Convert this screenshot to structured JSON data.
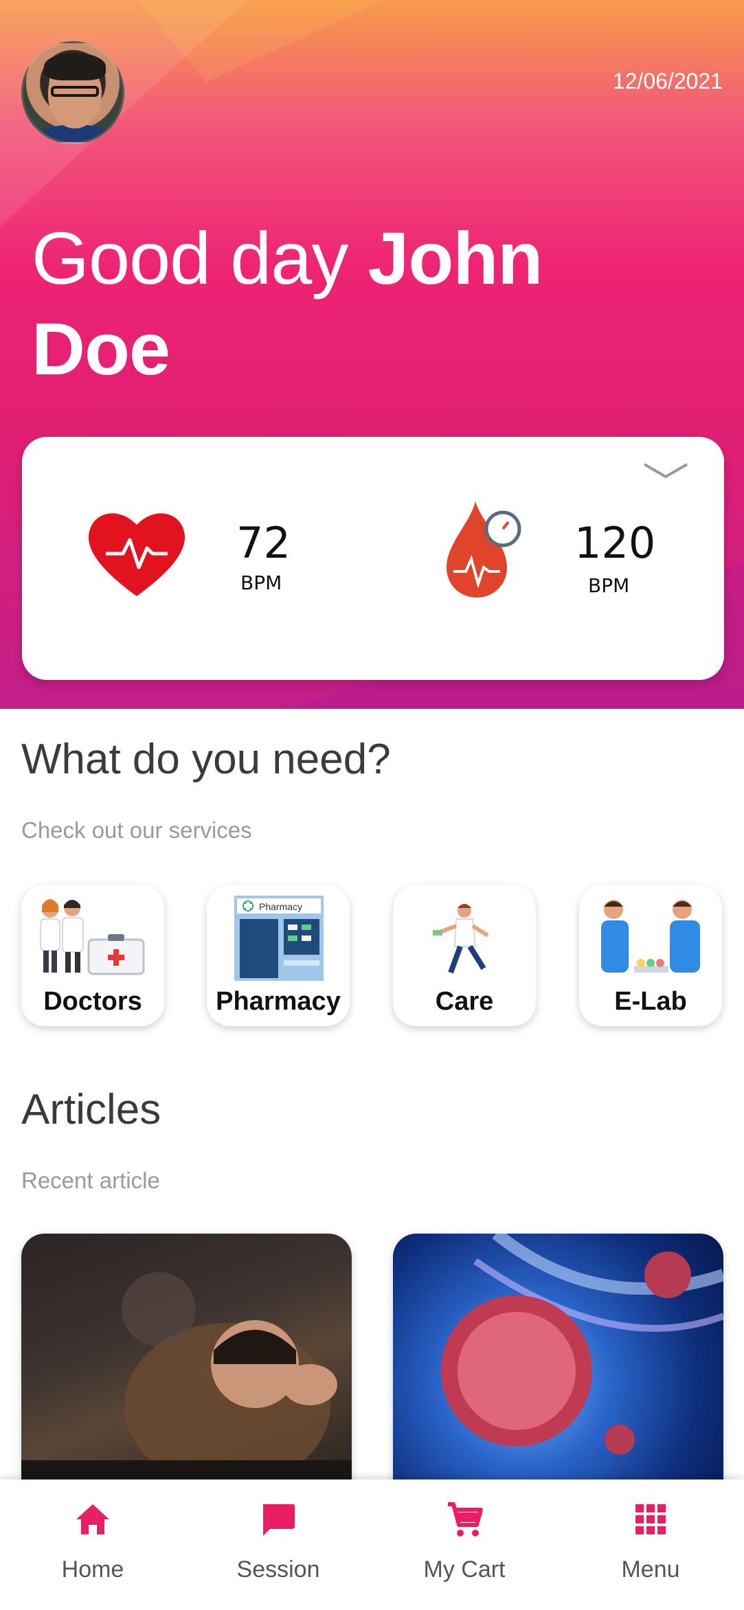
{
  "header": {
    "date": "12/06/2021",
    "greeting_prefix": "Good day",
    "user_first_name": "John",
    "user_last_name": "Doe"
  },
  "vitals": {
    "heart_rate": {
      "value": "72",
      "unit": "BPM",
      "icon": "heart-pulse-icon"
    },
    "blood_pressure": {
      "value": "120",
      "unit": "BPM",
      "icon": "blood-drop-gauge-icon"
    },
    "expand_icon": "chevron-down-icon"
  },
  "services": {
    "title": "What do you need?",
    "subtitle": "Check out our services",
    "items": [
      {
        "label": "Doctors",
        "icon": "doctors-icon"
      },
      {
        "label": "Pharmacy",
        "icon": "pharmacy-icon",
        "sign": "Pharmacy"
      },
      {
        "label": "Care",
        "icon": "care-icon"
      },
      {
        "label": "E-Lab",
        "icon": "lab-icon"
      }
    ]
  },
  "articles": {
    "title": "Articles",
    "subtitle": "Recent article"
  },
  "bottom_nav": {
    "items": [
      {
        "label": "Home",
        "icon": "home-icon",
        "active": true
      },
      {
        "label": "Session",
        "icon": "chat-icon"
      },
      {
        "label": "My Cart",
        "icon": "cart-icon"
      },
      {
        "label": "Menu",
        "icon": "grid-menu-icon"
      }
    ]
  },
  "colors": {
    "primary": "#e91e63",
    "header_gradient_top": "#f79a4a",
    "header_gradient_mid": "#ee2374",
    "header_gradient_bottom": "#c21f8a"
  }
}
